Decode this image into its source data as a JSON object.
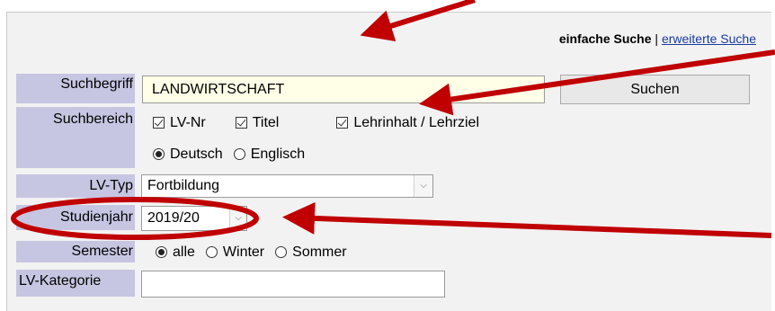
{
  "links": {
    "simple_search": "einfache Suche",
    "separator": " | ",
    "advanced_search": "erweiterte Suche"
  },
  "labels": {
    "suchbegriff": "Suchbegriff",
    "suchbereich": "Suchbereich",
    "lv_typ": "LV-Typ",
    "studienjahr": "Studienjahr",
    "semester": "Semester",
    "lv_kategorie": "LV-Kategorie"
  },
  "search": {
    "value": "LANDWIRTSCHAFT",
    "button": "Suchen"
  },
  "suchbereich": {
    "checkboxes": [
      {
        "label": "LV-Nr",
        "checked": true
      },
      {
        "label": "Titel",
        "checked": true
      },
      {
        "label": "Lehrinhalt / Lehrziel",
        "checked": true
      }
    ],
    "language": {
      "options": [
        "Deutsch",
        "Englisch"
      ],
      "selected": "Deutsch"
    }
  },
  "lv_typ": {
    "selected": "Fortbildung"
  },
  "studienjahr": {
    "selected": "2019/20"
  },
  "semester": {
    "options": [
      "alle",
      "Winter",
      "Sommer"
    ],
    "selected": "alle"
  },
  "lv_kategorie": {
    "value": ""
  },
  "colors": {
    "label_bg": "#c6c6e2",
    "annotation_red": "#c00000",
    "search_input_bg": "#ffffe8",
    "link": "#1a3c9e"
  }
}
